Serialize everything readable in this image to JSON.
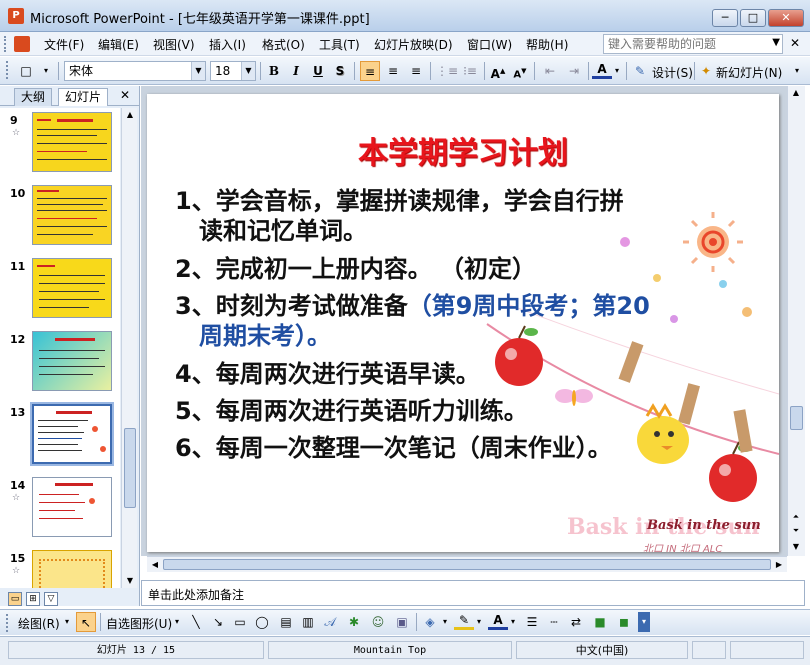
{
  "window": {
    "title": "Microsoft PowerPoint - [七年级英语开学第一课课件.ppt]",
    "minimize": "─",
    "maximize": "□",
    "close": "✕"
  },
  "menu": {
    "items": [
      "文件(F)",
      "编辑(E)",
      "视图(V)",
      "插入(I)",
      "格式(O)",
      "工具(T)",
      "幻灯片放映(D)",
      "窗口(W)",
      "帮助(H)"
    ],
    "help_placeholder": "键入需要帮助的问题",
    "doc_close": "✕"
  },
  "toolbar": {
    "font_name": "宋体",
    "font_size": "18",
    "bold": "B",
    "italic": "I",
    "underline": "U",
    "shadow": "S",
    "font_color_label": "A",
    "design_label": "设计(S)",
    "new_slide_label": "新幻灯片(N)"
  },
  "panel": {
    "tab_outline": "大纲",
    "tab_slides": "幻灯片",
    "close": "✕",
    "thumb_numbers": [
      "9",
      "10",
      "11",
      "12",
      "13",
      "14",
      "15"
    ],
    "selected_slide": "13"
  },
  "slide": {
    "title": "本学期学习计划",
    "bullets": [
      {
        "main": "1、学会音标，掌握拼读规律，学会自行拼",
        "cont": "读和记忆单词。"
      },
      {
        "main": "2、完成初一上册内容。 （初定）"
      },
      {
        "main": "3、时刻为考试做准备",
        "blue": "（第9周中段考；第20",
        "cont_blue": "周期末考）。"
      },
      {
        "main": "4、每周两次进行英语早读。"
      },
      {
        "main": "5、每周两次进行英语听力训练。"
      },
      {
        "main": "6、每周一次整理一次笔记（周末作业）。"
      }
    ],
    "watermark": "Bask in the sun",
    "deco_text": "Bask in the sun",
    "deco_small": "北口 IN 北口 ALC"
  },
  "notes": {
    "placeholder": "单击此处添加备注"
  },
  "drawbar": {
    "draw_label": "绘图(R)",
    "autoshape_label": "自选图形(U)"
  },
  "status": {
    "slide_pos": "幻灯片 13 / 15",
    "theme": "Mountain Top",
    "language": "中文(中国)"
  }
}
